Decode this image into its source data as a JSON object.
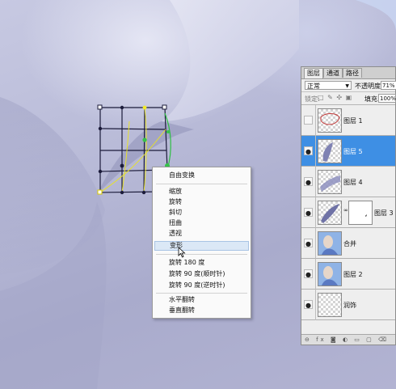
{
  "panel": {
    "tabs": [
      "图层",
      "通道",
      "路径"
    ],
    "blend_mode": "正常",
    "opacity_label": "不透明度:",
    "opacity_value": "71%",
    "lock_label": "锁定:",
    "lock_icons": "□ ✎ ✣ ▣",
    "fill_label": "填充:",
    "fill_value": "100%",
    "layers": [
      {
        "name": "图层 1",
        "visible": false,
        "selected": false
      },
      {
        "name": "图层 5",
        "visible": true,
        "selected": true
      },
      {
        "name": "图层 4",
        "visible": true,
        "selected": false
      },
      {
        "name": "图层 3",
        "visible": true,
        "selected": false
      },
      {
        "name": "合并",
        "visible": true,
        "selected": false
      },
      {
        "name": "图层 2",
        "visible": true,
        "selected": false
      },
      {
        "name": "润饰",
        "visible": true,
        "selected": false
      }
    ],
    "eye_glyph": "●",
    "footer_icons": "⊖ fx ◙ ◐ ▭ ▢ ⌫"
  },
  "menu": {
    "items": [
      "自由变换",
      "缩放",
      "旋转",
      "斜切",
      "扭曲",
      "透视",
      "变形",
      "旋转 180 度",
      "旋转 90 度(顺时针)",
      "旋转 90 度(逆时针)",
      "水平翻转",
      "垂直翻转"
    ],
    "highlighted": "变形"
  },
  "colors": {
    "selected_layer": "#3e8fe4",
    "warp_handle_yellow": "#f2ea2a",
    "warp_handle_green": "#35c24a"
  }
}
